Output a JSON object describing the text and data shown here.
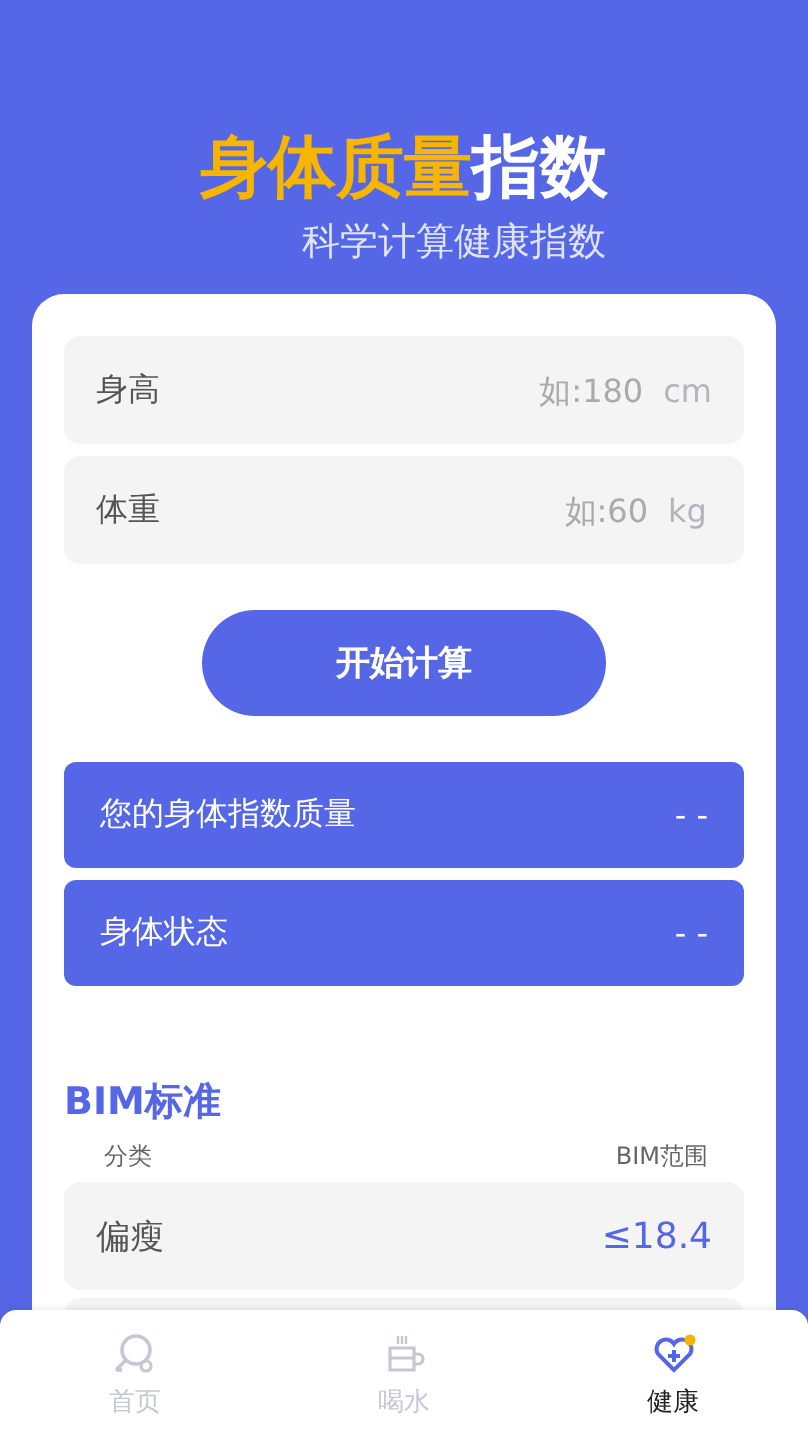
{
  "header": {
    "title_highlight": "身体质量",
    "title_rest": "指数",
    "subtitle": "科学计算健康指数"
  },
  "fields": [
    {
      "label": "身高",
      "placeholder": "如:180",
      "unit": "cm"
    },
    {
      "label": "体重",
      "placeholder": "如:60",
      "unit": "kg"
    }
  ],
  "calculate_button": "开始计算",
  "results": [
    {
      "label": "您的身体指数质量",
      "value": "- -"
    },
    {
      "label": "身体状态",
      "value": "- -"
    }
  ],
  "standard": {
    "title": "BIM标准",
    "columns": [
      "分类",
      "BIM范围"
    ],
    "rows": [
      {
        "category": "偏瘦",
        "range": "≤18.4"
      }
    ]
  },
  "tabs": [
    {
      "label": "首页",
      "kind": "home",
      "selected": false
    },
    {
      "label": "喝水",
      "kind": "cup",
      "selected": false
    },
    {
      "label": "健康",
      "kind": "heart",
      "selected": true
    }
  ]
}
